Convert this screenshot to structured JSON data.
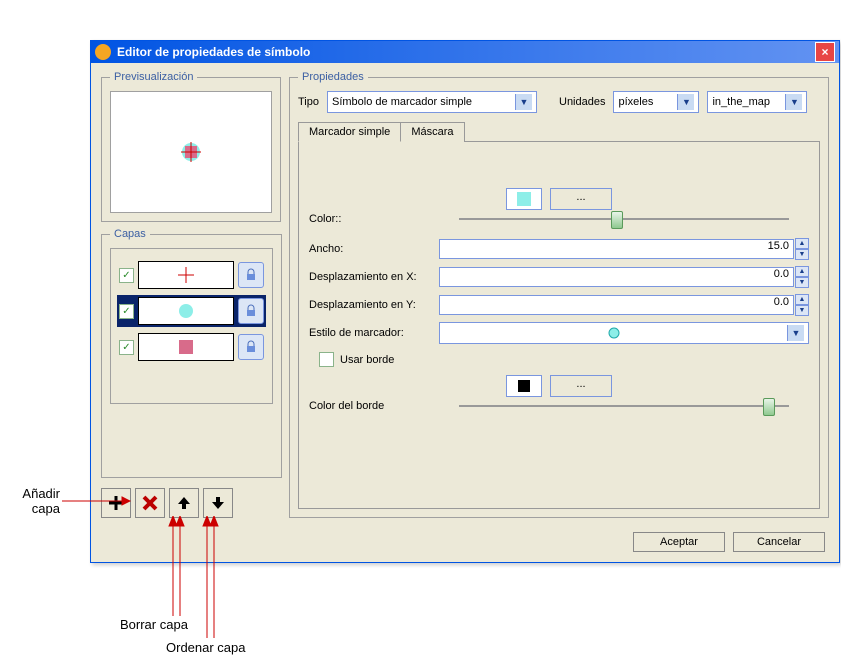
{
  "window": {
    "title": "Editor de propiedades de símbolo",
    "close": "×"
  },
  "panels": {
    "preview": "Previsualización",
    "layers": "Capas",
    "props": "Propiedades"
  },
  "props": {
    "type_label": "Tipo",
    "type_value": "Símbolo de marcador simple",
    "units_label": "Unidades",
    "units_value": "píxeles",
    "context_value": "in_the_map"
  },
  "tabs": {
    "simple_marker": "Marcador simple",
    "mask": "Máscara"
  },
  "fields": {
    "color_label": "Color::",
    "more": "...",
    "width_label": "Ancho:",
    "width_value": "15.0",
    "offx_label": "Desplazamiento en X:",
    "offx_value": "0.0",
    "offy_label": "Desplazamiento en Y:",
    "offy_value": "0.0",
    "style_label": "Estilo de marcador:",
    "use_border_label": "Usar borde",
    "border_color_label": "Color del borde"
  },
  "buttons": {
    "ok": "Aceptar",
    "cancel": "Cancelar"
  },
  "annotations": {
    "add": "Añadir\ncapa",
    "del": "Borrar capa",
    "order": "Ordenar capa"
  },
  "colors": {
    "main": "#8deee8",
    "border": "#000"
  }
}
